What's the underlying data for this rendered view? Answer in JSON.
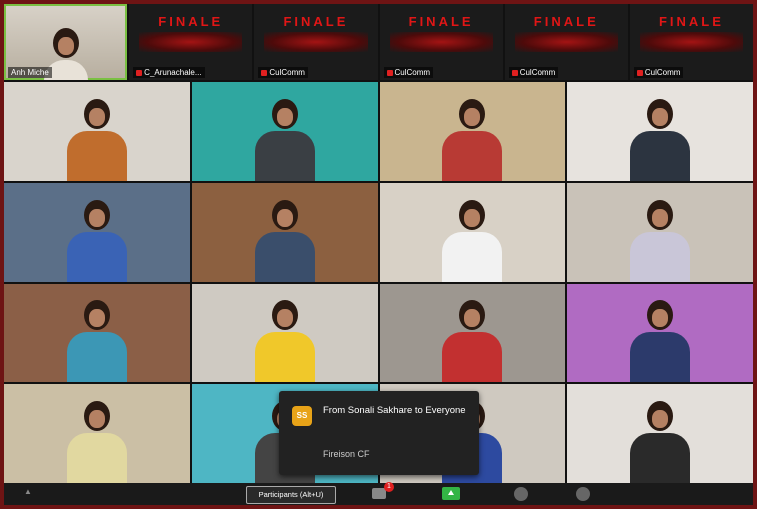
{
  "top_strip": [
    {
      "label": "Anh Miche",
      "kind": "camera",
      "active": true
    },
    {
      "label": "C_Arunachale...",
      "kind": "screen",
      "screen_title": "FINALE",
      "mic_off": true
    },
    {
      "label": "CulComm",
      "kind": "screen",
      "screen_title": "FINALE",
      "mic_off": true
    },
    {
      "label": "CulComm",
      "kind": "screen",
      "screen_title": "FINALE",
      "mic_off": true
    },
    {
      "label": "CulComm",
      "kind": "screen",
      "screen_title": "FINALE",
      "mic_off": true
    },
    {
      "label": "CulComm",
      "kind": "screen",
      "screen_title": "FINALE",
      "mic_off": true
    }
  ],
  "grid_tiles": [
    {
      "bg": "#d9d4cc",
      "shirt": "#c06d2d"
    },
    {
      "bg": "#2fa7a0",
      "shirt": "#3a3f44"
    },
    {
      "bg": "#c9b58f",
      "shirt": "#b83a34"
    },
    {
      "bg": "#e7e3de",
      "shirt": "#2c3440"
    },
    {
      "bg": "#5b6f88",
      "shirt": "#3a63b5"
    },
    {
      "bg": "#8c6040",
      "shirt": "#3a4e6b"
    },
    {
      "bg": "#d8d1c6",
      "shirt": "#f2f2f2"
    },
    {
      "bg": "#c9c2b8",
      "shirt": "#c9c6d8"
    },
    {
      "bg": "#8b5f47",
      "shirt": "#3c97b5"
    },
    {
      "bg": "#cfcac2",
      "shirt": "#f0c82a"
    },
    {
      "bg": "#9d9790",
      "shirt": "#c23030"
    },
    {
      "bg": "#b06bc2",
      "shirt": "#2c3a6b"
    },
    {
      "bg": "#cbbfa5",
      "shirt": "#e1d8a0"
    },
    {
      "bg": "#4eb6c4",
      "shirt": "#444"
    },
    {
      "bg": "#cfc9c0",
      "shirt": "#2d4aa0"
    },
    {
      "bg": "#e3dfda",
      "shirt": "#2a2a2a"
    }
  ],
  "chat_toast": {
    "avatar_initials": "SS",
    "title": "From Sonali Sakhare to Everyone",
    "message": "Fireison CF"
  },
  "toolbar": {
    "participants_label": "Participants (Alt+U)",
    "chat_badge": "1"
  },
  "colors": {
    "frame_bg": "#6e1414",
    "active_speaker": "#7ac043",
    "share_green": "#33b545",
    "badge_red": "#e02020"
  }
}
